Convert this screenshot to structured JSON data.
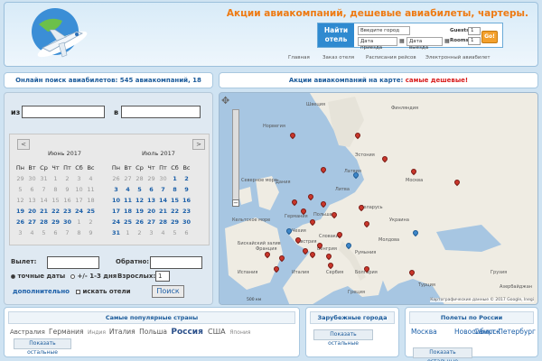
{
  "header": {
    "slogan": "Акции авиакомпаний, дешевые авиабилеты, чартеры.",
    "hotel_widget": {
      "find_hotel_label": "Найти отель",
      "city_placeholder": "Введите город",
      "checkin_placeholder": "Дата приезда",
      "checkout_placeholder": "Дата выезда",
      "guests_label": "Guests",
      "guests_value": "1",
      "rooms_label": "Rooms",
      "rooms_value": "1",
      "go_label": "Go!"
    },
    "nav": [
      "Главная",
      "Заказ отеля",
      "Расписания рейсов",
      "Электронный авиабилет"
    ]
  },
  "info_bar": {
    "text": "Онлайн поиск авиабилетов: 545 авиакомпаний, 18 авиакасс"
  },
  "map_bar": {
    "text": "Акции авиакомпаний на карте: ",
    "highlight": "самые дешевые!"
  },
  "search": {
    "from_label": "из",
    "to_label": "в",
    "prev_label": "<",
    "next_label": ">",
    "month1": "Июнь 2017",
    "month2": "Июль 2017",
    "weekdays": [
      "Пн",
      "Вт",
      "Ср",
      "Чт",
      "Пт",
      "Сб",
      "Вс"
    ],
    "month1_days": [
      [
        "29",
        "30",
        "31",
        "1",
        "2",
        "3",
        "4"
      ],
      [
        "5",
        "6",
        "7",
        "8",
        "9",
        "10",
        "11"
      ],
      [
        "12",
        "13",
        "14",
        "15",
        "16",
        "17",
        "18"
      ],
      [
        "19",
        "20",
        "21",
        "22",
        "23",
        "24",
        "25"
      ],
      [
        "26",
        "27",
        "28",
        "29",
        "30",
        "1",
        "2"
      ],
      [
        "3",
        "4",
        "5",
        "6",
        "7",
        "8",
        "9"
      ]
    ],
    "month1_dim_rows": [
      [
        0,
        1,
        2,
        3,
        4,
        5,
        6
      ],
      [
        0,
        1,
        2,
        3,
        4,
        5,
        6
      ],
      [
        0,
        1,
        2,
        3,
        4,
        5,
        6
      ],
      [],
      [
        5,
        6
      ],
      [
        0,
        1,
        2,
        3,
        4,
        5,
        6
      ]
    ],
    "month2_days": [
      [
        "26",
        "27",
        "28",
        "29",
        "30",
        "1",
        "2"
      ],
      [
        "3",
        "4",
        "5",
        "6",
        "7",
        "8",
        "9"
      ],
      [
        "10",
        "11",
        "12",
        "13",
        "14",
        "15",
        "16"
      ],
      [
        "17",
        "18",
        "19",
        "20",
        "21",
        "22",
        "23"
      ],
      [
        "24",
        "25",
        "26",
        "27",
        "28",
        "29",
        "30"
      ],
      [
        "31",
        "1",
        "2",
        "3",
        "4",
        "5",
        "6"
      ]
    ],
    "month2_dim_rows": [
      [
        0,
        1,
        2,
        3,
        4
      ],
      [],
      [],
      [],
      [],
      [
        1,
        2,
        3,
        4,
        5,
        6
      ]
    ],
    "departure_label": "Вылет:",
    "return_label": "Обратно:",
    "exact_dates_label": "точные даты",
    "flex_dates_label": "+/- 1-3 дня",
    "adults_label": "Взрослых:",
    "adults_value": "1",
    "advanced_link": "дополнительно",
    "hotels_label": "искать отели",
    "search_button": "Поиск"
  },
  "map": {
    "labels": [
      "Швеция",
      "Финляндия",
      "Норвегия",
      "Эстония",
      "Латвия",
      "Москва",
      "Литва",
      "Беларусь",
      "Дания",
      "Польша",
      "Германия",
      "Украина",
      "Чехия",
      "Франция",
      "Словакия",
      "Австрия",
      "Венгрия",
      "Румыния",
      "Молдова",
      "Италия",
      "Сербия",
      "Болгария",
      "Испания",
      "Греция",
      "Турция",
      "Грузия",
      "Азербайджан",
      "Северное море",
      "Кельтское море",
      "Бискайский залив"
    ],
    "attribution": "Картографические данные © 2017 Google, Inegi",
    "scale": "500 км"
  },
  "bottom": {
    "countries": {
      "title": "Самые популярные страны",
      "items": [
        "Австралия",
        "Германия",
        "Индия",
        "Италия",
        "Польша",
        "Россия",
        "США",
        "Япония"
      ],
      "show_all": "Показать остальные"
    },
    "foreign_cities": {
      "title": "Зарубежные города",
      "show_all": "Показать остальные"
    },
    "russia_flights": {
      "title": "Полеты по России",
      "items": [
        "Москва",
        "Новосибирск",
        "Санкт-Петербург"
      ],
      "show_all": "Показать остальные"
    }
  },
  "colors": {
    "accent_orange": "#ee7a12",
    "link_blue": "#1b5fa8",
    "title_blue": "#1a5a9a",
    "highlight_red": "#d81c1c"
  }
}
